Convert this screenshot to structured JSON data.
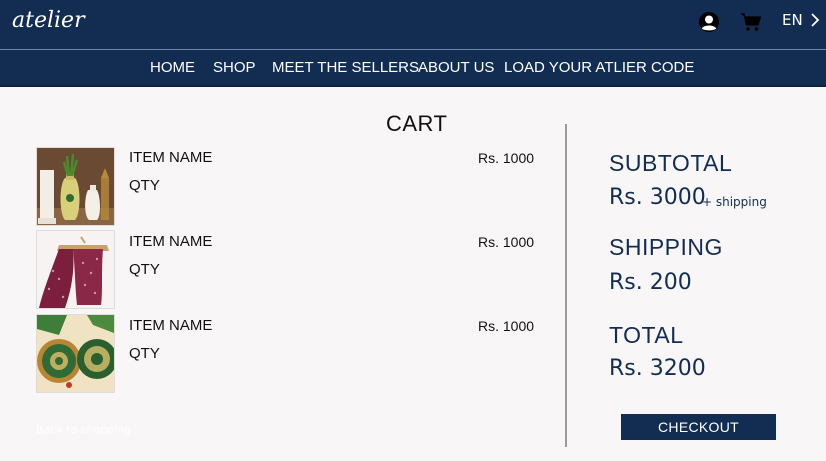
{
  "brand": {
    "logo_text": "atelier"
  },
  "header": {
    "language": "EN",
    "icons": [
      "account-icon",
      "cart-icon",
      "chevron-right-icon"
    ]
  },
  "nav": {
    "items": [
      {
        "label": "HOME"
      },
      {
        "label": "SHOP"
      },
      {
        "label": "MEET THE SELLERS"
      },
      {
        "label": "ABOUT US"
      },
      {
        "label": "LOAD YOUR ATLIER CODE"
      }
    ]
  },
  "cart": {
    "title": "CART",
    "items": [
      {
        "name": "ITEM NAME",
        "qty_label": "QTY",
        "price": "Rs. 1000",
        "thumbnail": "vases-photo"
      },
      {
        "name": "ITEM NAME",
        "qty_label": "QTY",
        "price": "Rs. 1000",
        "thumbnail": "dupatta-photo"
      },
      {
        "name": "ITEM NAME",
        "qty_label": "QTY",
        "price": "Rs. 1000",
        "thumbnail": "painted-plates-photo"
      }
    ],
    "back_link": "Back to shopping"
  },
  "summary": {
    "subtotal_label": "SUBTOTAL",
    "subtotal_value": "Rs. 3000",
    "subtotal_note": "+ shipping",
    "shipping_label": "SHIPPING",
    "shipping_value": "Rs. 200",
    "total_label": "TOTAL",
    "total_value": "Rs. 3200",
    "checkout_label": "CHECKOUT"
  },
  "colors": {
    "navy": "#132d52",
    "background": "#f8f6f7",
    "divider": "#9a9a9a"
  }
}
